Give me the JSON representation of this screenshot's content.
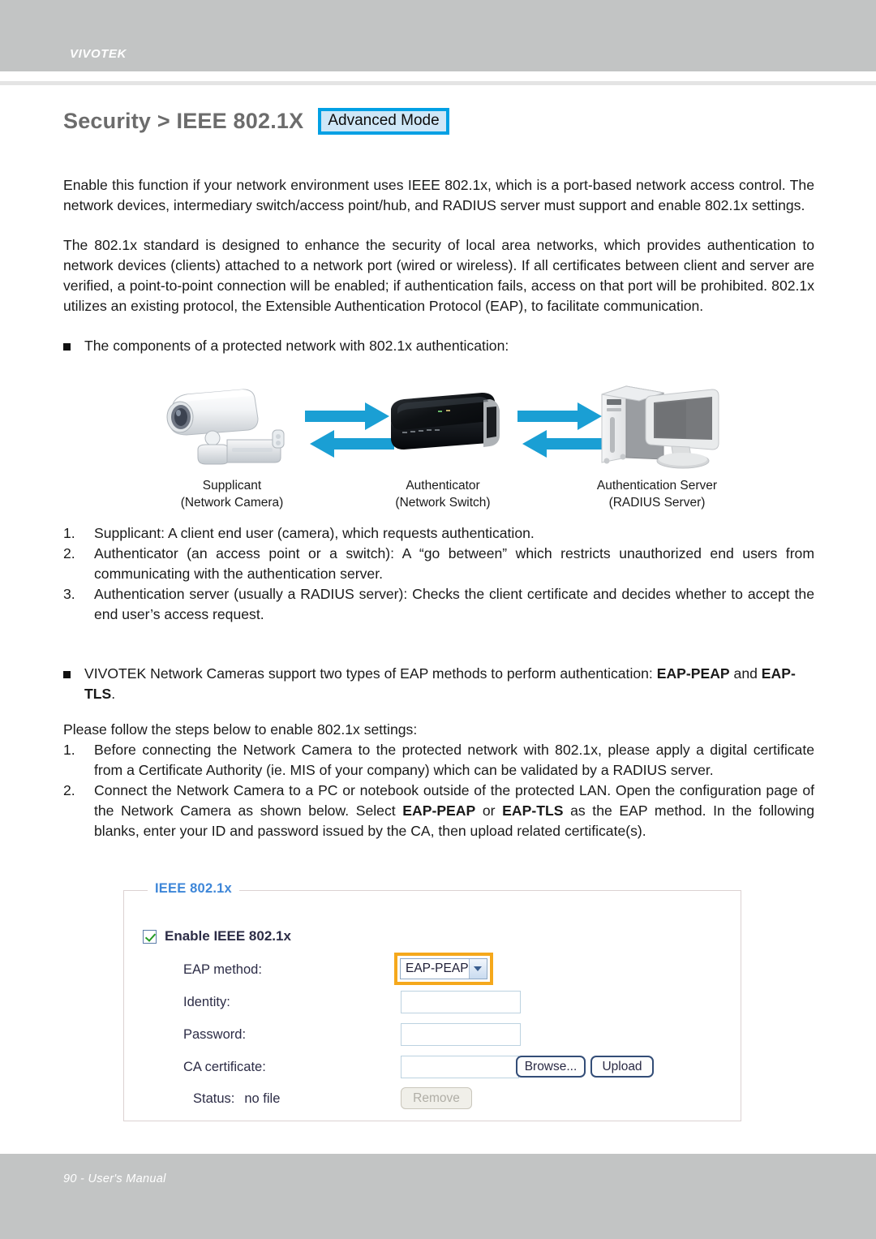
{
  "header": {
    "brand": "VIVOTEK"
  },
  "title": {
    "text": "Security > IEEE 802.1X",
    "badge": "Advanced Mode"
  },
  "body": {
    "para1": "Enable this function if your network environment uses IEEE 802.1x, which is a port-based network access control. The network devices, intermediary switch/access point/hub, and RADIUS server must support and enable 802.1x settings.",
    "para2": "The 802.1x standard is designed to enhance the security of local area networks, which provides authentication to network devices (clients) attached to a network port (wired or wireless). If all certificates between client and server are verified, a point-to-point connection will be enabled; if authentication fails, access on that port will be prohibited. 802.1x utilizes an existing protocol, the Extensible Authentication Protocol (EAP), to facilitate communication.",
    "bullet1": "The components of a protected network with 802.1x authentication:",
    "bullet2_prefix": "VIVOTEK Network Cameras support two types of EAP methods to perform authentication: ",
    "bullet2_bold1": "EAP-PEAP",
    "bullet2_mid": " and ",
    "bullet2_bold2": "EAP-TLS",
    "bullet2_suffix": ".",
    "steps_intro": "Please follow the steps below to enable 802.1x settings:"
  },
  "diagram": {
    "nodes": [
      {
        "icon": "network-camera-icon",
        "caption_line1": "Supplicant",
        "caption_line2": "(Network Camera)"
      },
      {
        "icon": "network-switch-icon",
        "caption_line1": "Authenticator",
        "caption_line2": "(Network Switch)"
      },
      {
        "icon": "radius-server-icon",
        "caption_line1": "Authentication Server",
        "caption_line2": "(RADIUS Server)"
      }
    ],
    "arrow_color": "#1a9fd4"
  },
  "component_list": [
    {
      "num": "1.",
      "text": "Supplicant: A client end user (camera), which requests authentication."
    },
    {
      "num": "2.",
      "text": "Authenticator (an access point or a switch): A “go between” which restricts unauthorized end users from communicating with the authentication server."
    },
    {
      "num": "3.",
      "text": "Authentication server (usually a RADIUS server): Checks the client certificate and decides whether to accept the end user’s access request."
    }
  ],
  "steps_list": [
    {
      "num": "1.",
      "text": "Before connecting the Network Camera to the protected network with 802.1x, please apply a digital certificate from a Certificate Authority (ie. MIS of your company) which can be validated by a RADIUS server."
    },
    {
      "num": "2.",
      "part1": "Connect the Network Camera to a PC or notebook outside of the protected LAN. Open the configuration page of the Network Camera as shown below. Select ",
      "bold1": "EAP-PEAP",
      "part2": " or ",
      "bold2": "EAP-TLS",
      "part3": " as the EAP method. In the following blanks, enter your ID and password issued by the CA, then upload related certificate(s)."
    }
  ],
  "panel": {
    "legend": "IEEE 802.1x",
    "enable_checkbox_label": "Enable IEEE 802.1x",
    "enable_checkbox_checked": true,
    "fields": {
      "eap_method_label": "EAP method:",
      "eap_method_value": "EAP-PEAP",
      "identity_label": "Identity:",
      "identity_value": "",
      "password_label": "Password:",
      "password_value": "",
      "ca_cert_label": "CA certificate:",
      "ca_cert_value": "",
      "status_label": "Status:",
      "status_value": "no file"
    },
    "buttons": {
      "browse": "Browse...",
      "upload": "Upload",
      "remove": "Remove"
    },
    "highlight_color": "#f5a81c",
    "legend_color": "#3d86d8"
  },
  "footer": {
    "text": "90 - User's Manual"
  }
}
